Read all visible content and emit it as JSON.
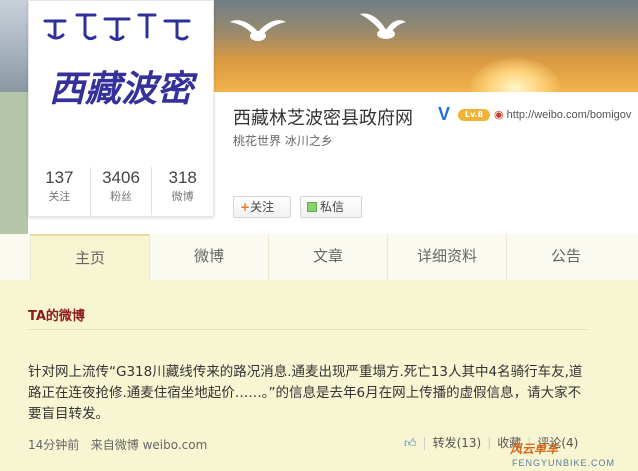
{
  "profile": {
    "name": "西藏林芝波密县政府网",
    "verified_mark": "V",
    "level": "Lv.8",
    "url": "http://weibo.com/bomigov",
    "bio": "桃花世界 冰川之乡",
    "avatar_text": "西藏波密",
    "stats": [
      {
        "value": "137",
        "label": "关注"
      },
      {
        "value": "3406",
        "label": "粉丝"
      },
      {
        "value": "318",
        "label": "微博"
      }
    ],
    "follow_label": "关注",
    "message_label": "私信"
  },
  "tabs": [
    {
      "label": "主页",
      "active": true
    },
    {
      "label": "微博"
    },
    {
      "label": "文章"
    },
    {
      "label": "详细资料"
    },
    {
      "label": "公告"
    }
  ],
  "feed": {
    "section_title": "TA的微博",
    "post": {
      "text": "针对网上流传“G318川藏线传来的路况消息.通麦出现严重塌方.死亡13人其中4名骑行车友,道路正在连夜抢修.通麦住宿坐地起价……。”的信息是去年6月在网上传播的虚假信息，请大家不要盲目转发。",
      "time": "14分钟前",
      "source_prefix": "来自微博",
      "source": "weibo.com",
      "repost_label": "转发(13)",
      "favorite_label": "收藏",
      "comment_label": "评论(4)"
    }
  },
  "watermark": {
    "brand": "风云单车",
    "domain": "FENGYUNBIKE.COM"
  },
  "colors": {
    "page_bg": "#f8f5d3",
    "title_red": "#8c1b1b",
    "verified_blue": "#1f6fcf",
    "level_badge": "#f2b233"
  }
}
